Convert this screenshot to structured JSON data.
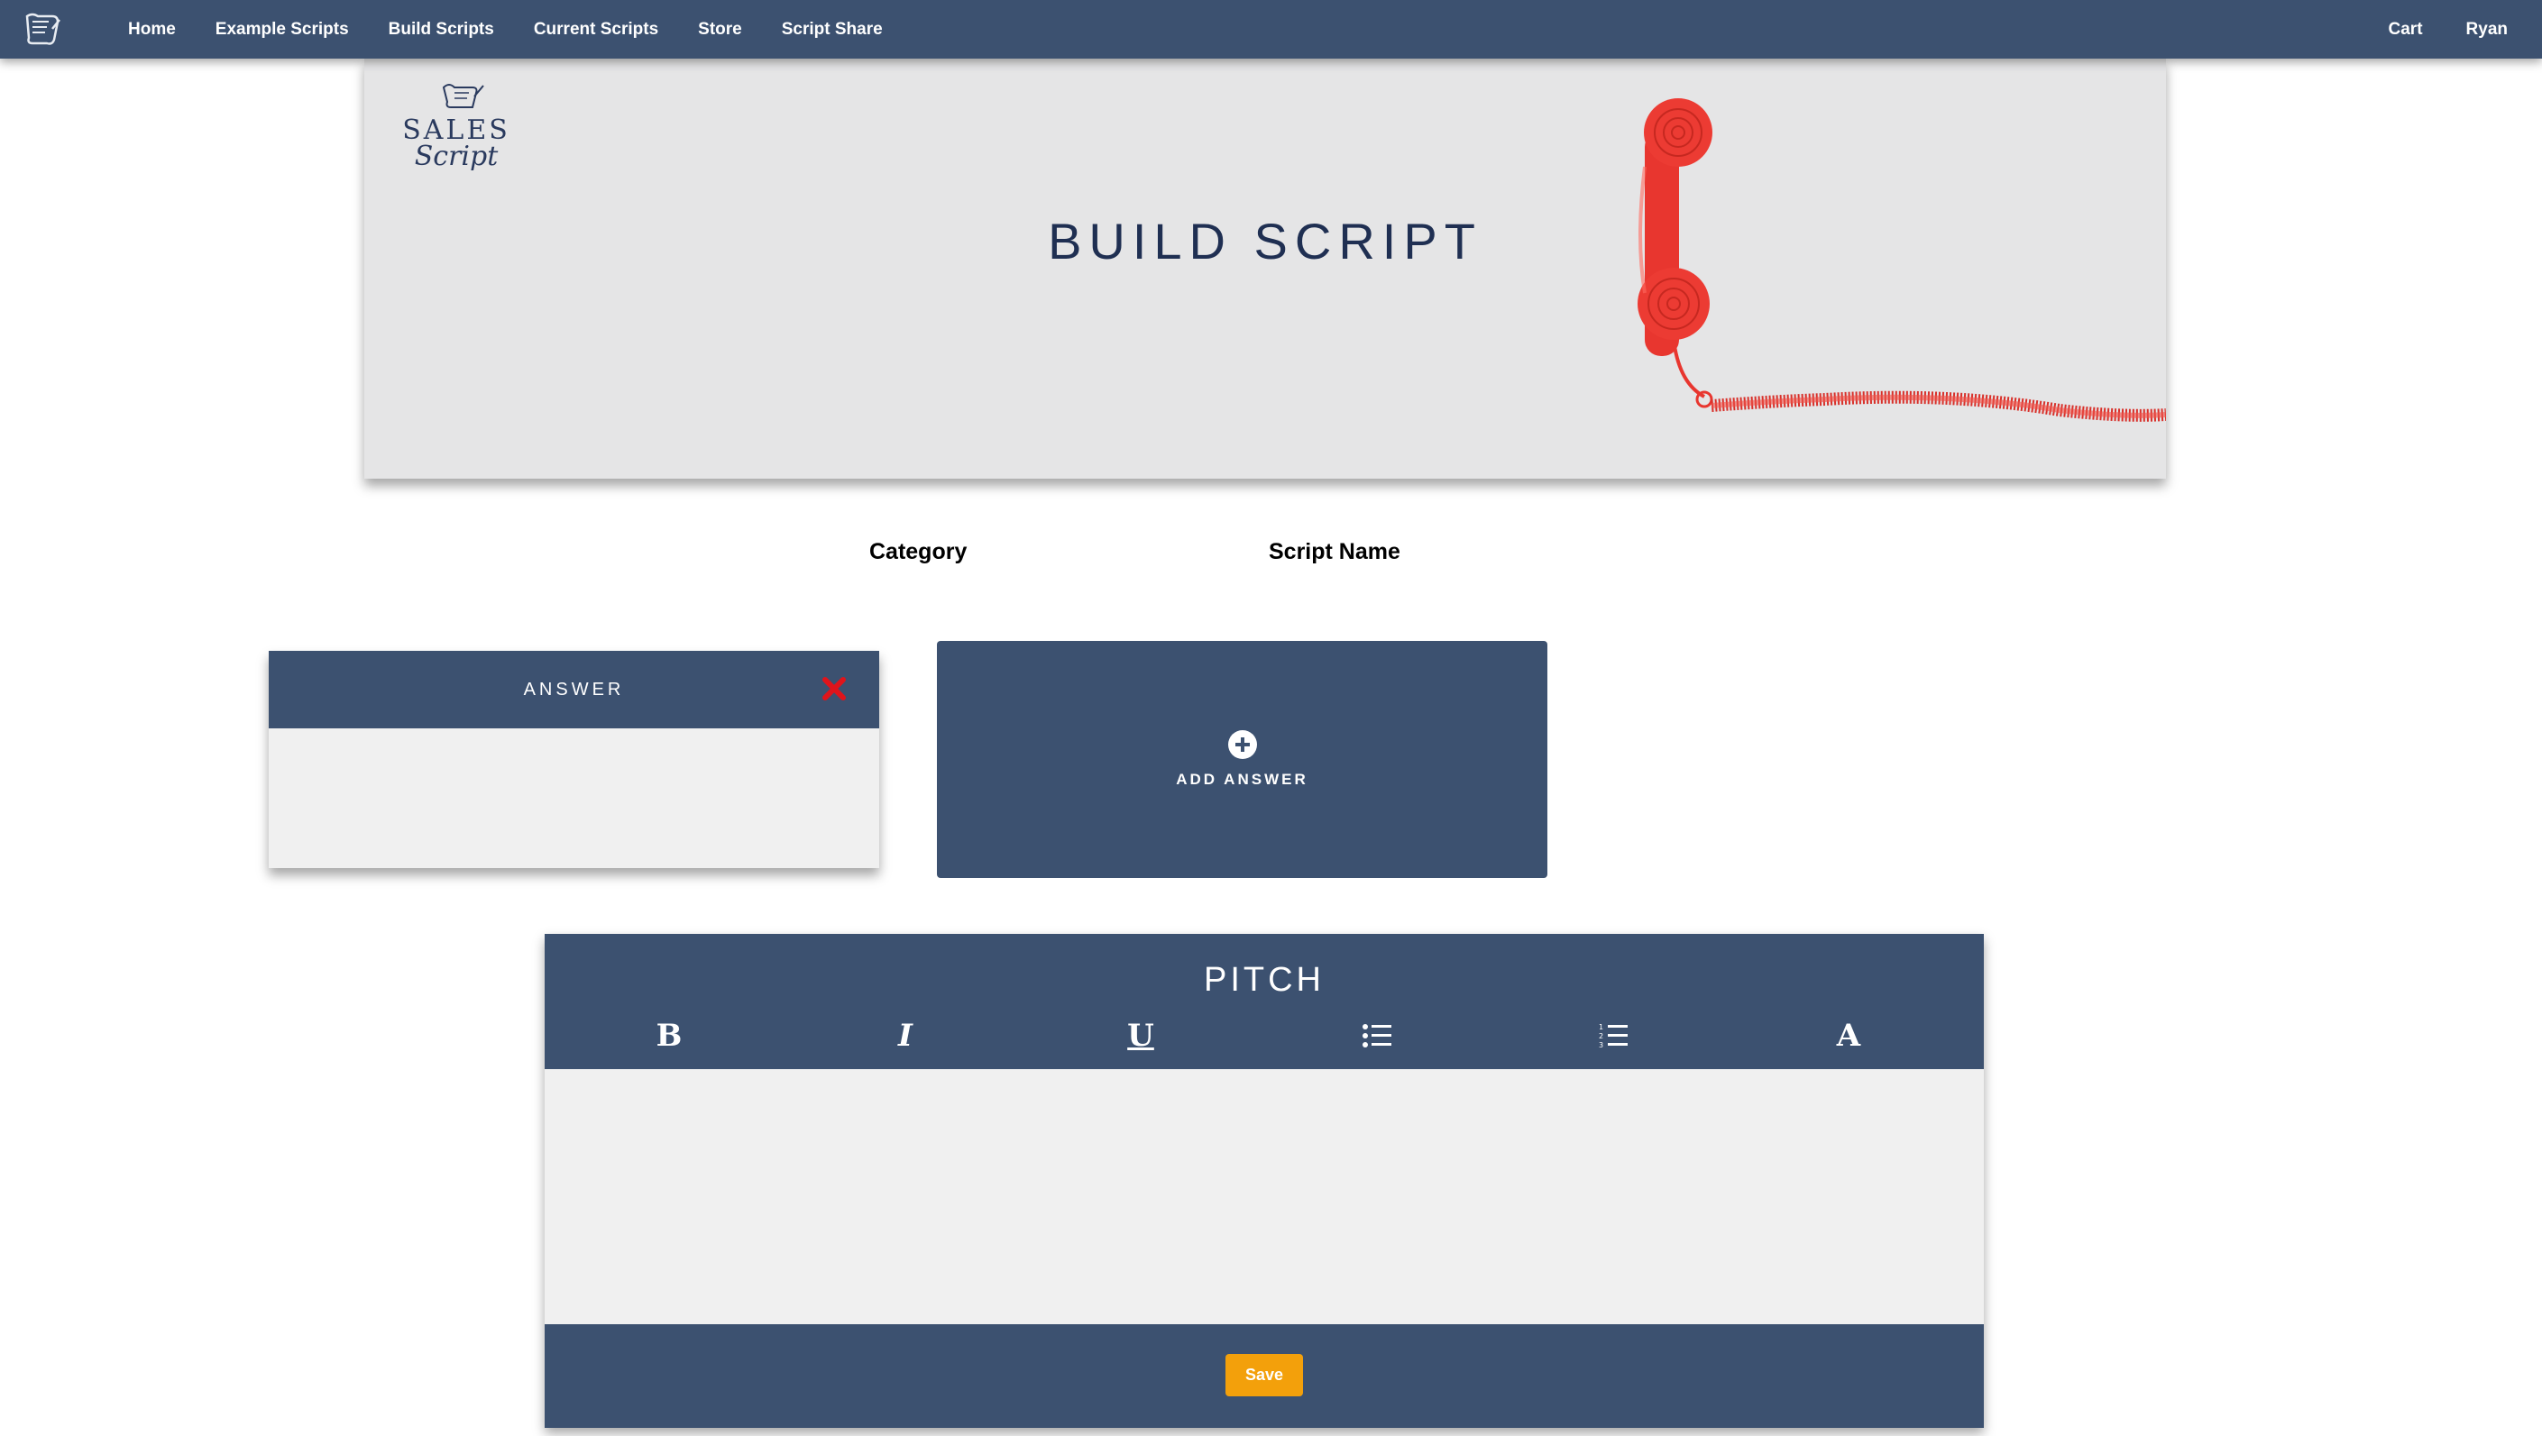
{
  "nav": {
    "logo_icon": "scroll-icon",
    "links": [
      "Home",
      "Example Scripts",
      "Build Scripts",
      "Current Scripts",
      "Store",
      "Script Share"
    ],
    "cart": "Cart",
    "user": "Ryan"
  },
  "hero": {
    "brand_text_top": "SALES",
    "brand_text_bottom": "Script",
    "title": "BUILD SCRIPT",
    "image": "red-telephone-handset"
  },
  "form": {
    "category_label": "Category",
    "script_name_label": "Script Name"
  },
  "answer_card": {
    "title": "ANSWER",
    "close_icon": "close-icon"
  },
  "add_answer": {
    "icon": "plus-circle-icon",
    "label": "ADD ANSWER"
  },
  "pitch": {
    "title": "PITCH",
    "tools": [
      "bold-icon",
      "italic-icon",
      "underline-icon",
      "bullet-list-icon",
      "numbered-list-icon",
      "font-icon"
    ],
    "save_label": "Save"
  },
  "colors": {
    "primary": "#3c5170",
    "hero_bg": "#e5e5e6",
    "title": "#1f2f52",
    "save": "#f3a00b",
    "close": "#e0141b",
    "phone": "#e8362f"
  }
}
